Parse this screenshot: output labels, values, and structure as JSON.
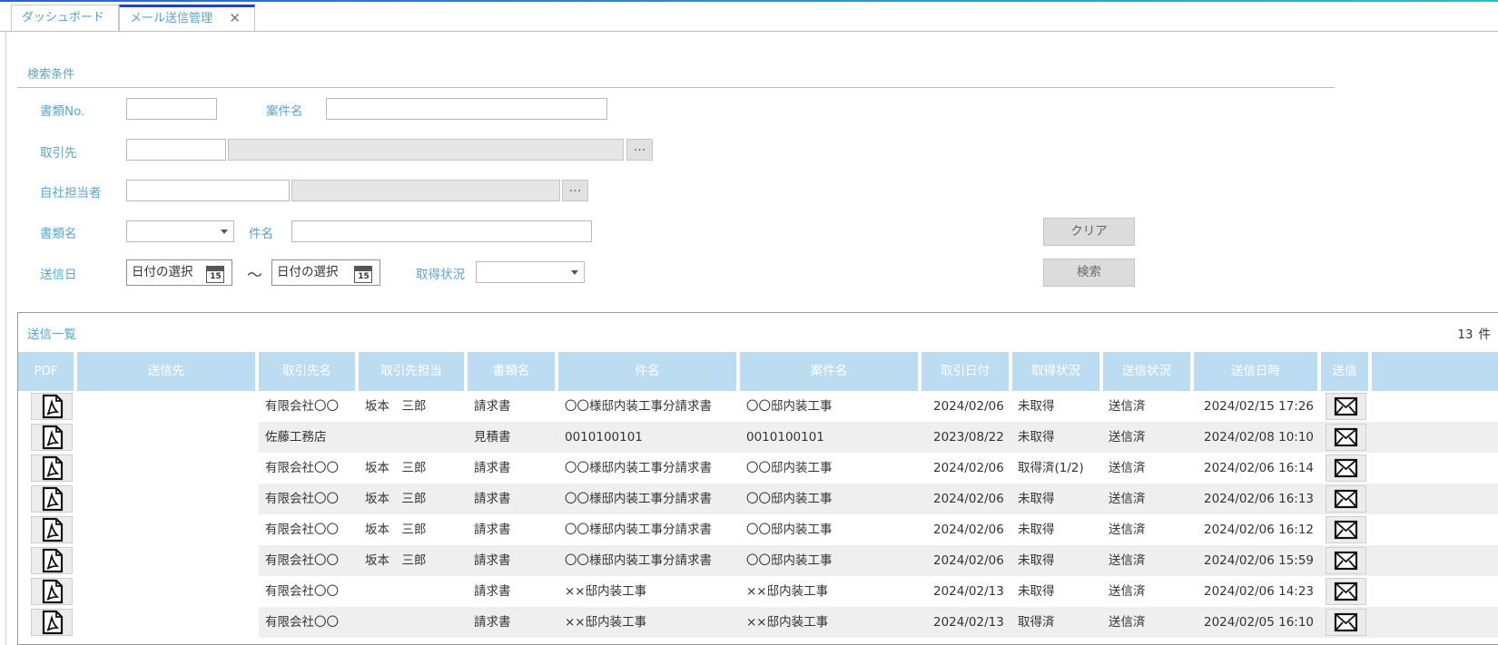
{
  "tabs": [
    {
      "label": "ダッシュボード"
    },
    {
      "label": "メール送信管理",
      "close": "✕"
    }
  ],
  "search": {
    "title": "検索条件",
    "doc_no_label": "書類No.",
    "project_label": "案件名",
    "client_label": "取引先",
    "staff_label": "自社担当者",
    "doc_name_label": "書類名",
    "subject_label": "件名",
    "send_date_label": "送信日",
    "date_from_placeholder": "日付の選択",
    "date_to_placeholder": "日付の選択",
    "tilde": "～",
    "status_label": "取得状況",
    "calendar_day": "15",
    "dots": "…",
    "clear_button": "クリア",
    "search_button": "検索"
  },
  "list": {
    "title": "送信一覧",
    "count": "13",
    "count_unit": "件",
    "columns": [
      "PDF",
      "送信先",
      "取引先名",
      "取引先担当",
      "書類名",
      "件名",
      "案件名",
      "取引日付",
      "取得状況",
      "送信状況",
      "送信日時",
      "送信"
    ],
    "rows": [
      {
        "client": "有限会社〇〇",
        "contact": "坂本　三郎",
        "doc": "請求書",
        "subject": "〇〇様邸内装工事分請求書",
        "project": "〇〇邸内装工事",
        "date": "2024/02/06",
        "status": "未取得",
        "send_status": "送信済",
        "sent_at": "2024/02/15 17:26"
      },
      {
        "client": "佐藤工務店",
        "contact": "",
        "doc": "見積書",
        "subject": "0010100101",
        "project": "0010100101",
        "date": "2023/08/22",
        "status": "未取得",
        "send_status": "送信済",
        "sent_at": "2024/02/08 10:10"
      },
      {
        "client": "有限会社〇〇",
        "contact": "坂本　三郎",
        "doc": "請求書",
        "subject": "〇〇様邸内装工事分請求書",
        "project": "〇〇邸内装工事",
        "date": "2024/02/06",
        "status": "取得済(1/2)",
        "send_status": "送信済",
        "sent_at": "2024/02/06 16:14"
      },
      {
        "client": "有限会社〇〇",
        "contact": "坂本　三郎",
        "doc": "請求書",
        "subject": "〇〇様邸内装工事分請求書",
        "project": "〇〇邸内装工事",
        "date": "2024/02/06",
        "status": "未取得",
        "send_status": "送信済",
        "sent_at": "2024/02/06 16:13"
      },
      {
        "client": "有限会社〇〇",
        "contact": "坂本　三郎",
        "doc": "請求書",
        "subject": "〇〇様邸内装工事分請求書",
        "project": "〇〇邸内装工事",
        "date": "2024/02/06",
        "status": "未取得",
        "send_status": "送信済",
        "sent_at": "2024/02/06 16:12"
      },
      {
        "client": "有限会社〇〇",
        "contact": "坂本　三郎",
        "doc": "請求書",
        "subject": "〇〇様邸内装工事分請求書",
        "project": "〇〇邸内装工事",
        "date": "2024/02/06",
        "status": "未取得",
        "send_status": "送信済",
        "sent_at": "2024/02/06 15:59"
      },
      {
        "client": "有限会社〇〇",
        "contact": "",
        "doc": "請求書",
        "subject": "××邸内装工事",
        "project": "××邸内装工事",
        "date": "2024/02/13",
        "status": "未取得",
        "send_status": "送信済",
        "sent_at": "2024/02/06 14:23"
      },
      {
        "client": "有限会社〇〇",
        "contact": "",
        "doc": "請求書",
        "subject": "××邸内装工事",
        "project": "××邸内装工事",
        "date": "2024/02/13",
        "status": "取得済",
        "send_status": "送信済",
        "sent_at": "2024/02/05 16:10"
      }
    ]
  },
  "colors": {
    "accent": "#5aa6c6",
    "header_bg": "#bcdcf2",
    "tab_active": "#1f3fcf"
  }
}
